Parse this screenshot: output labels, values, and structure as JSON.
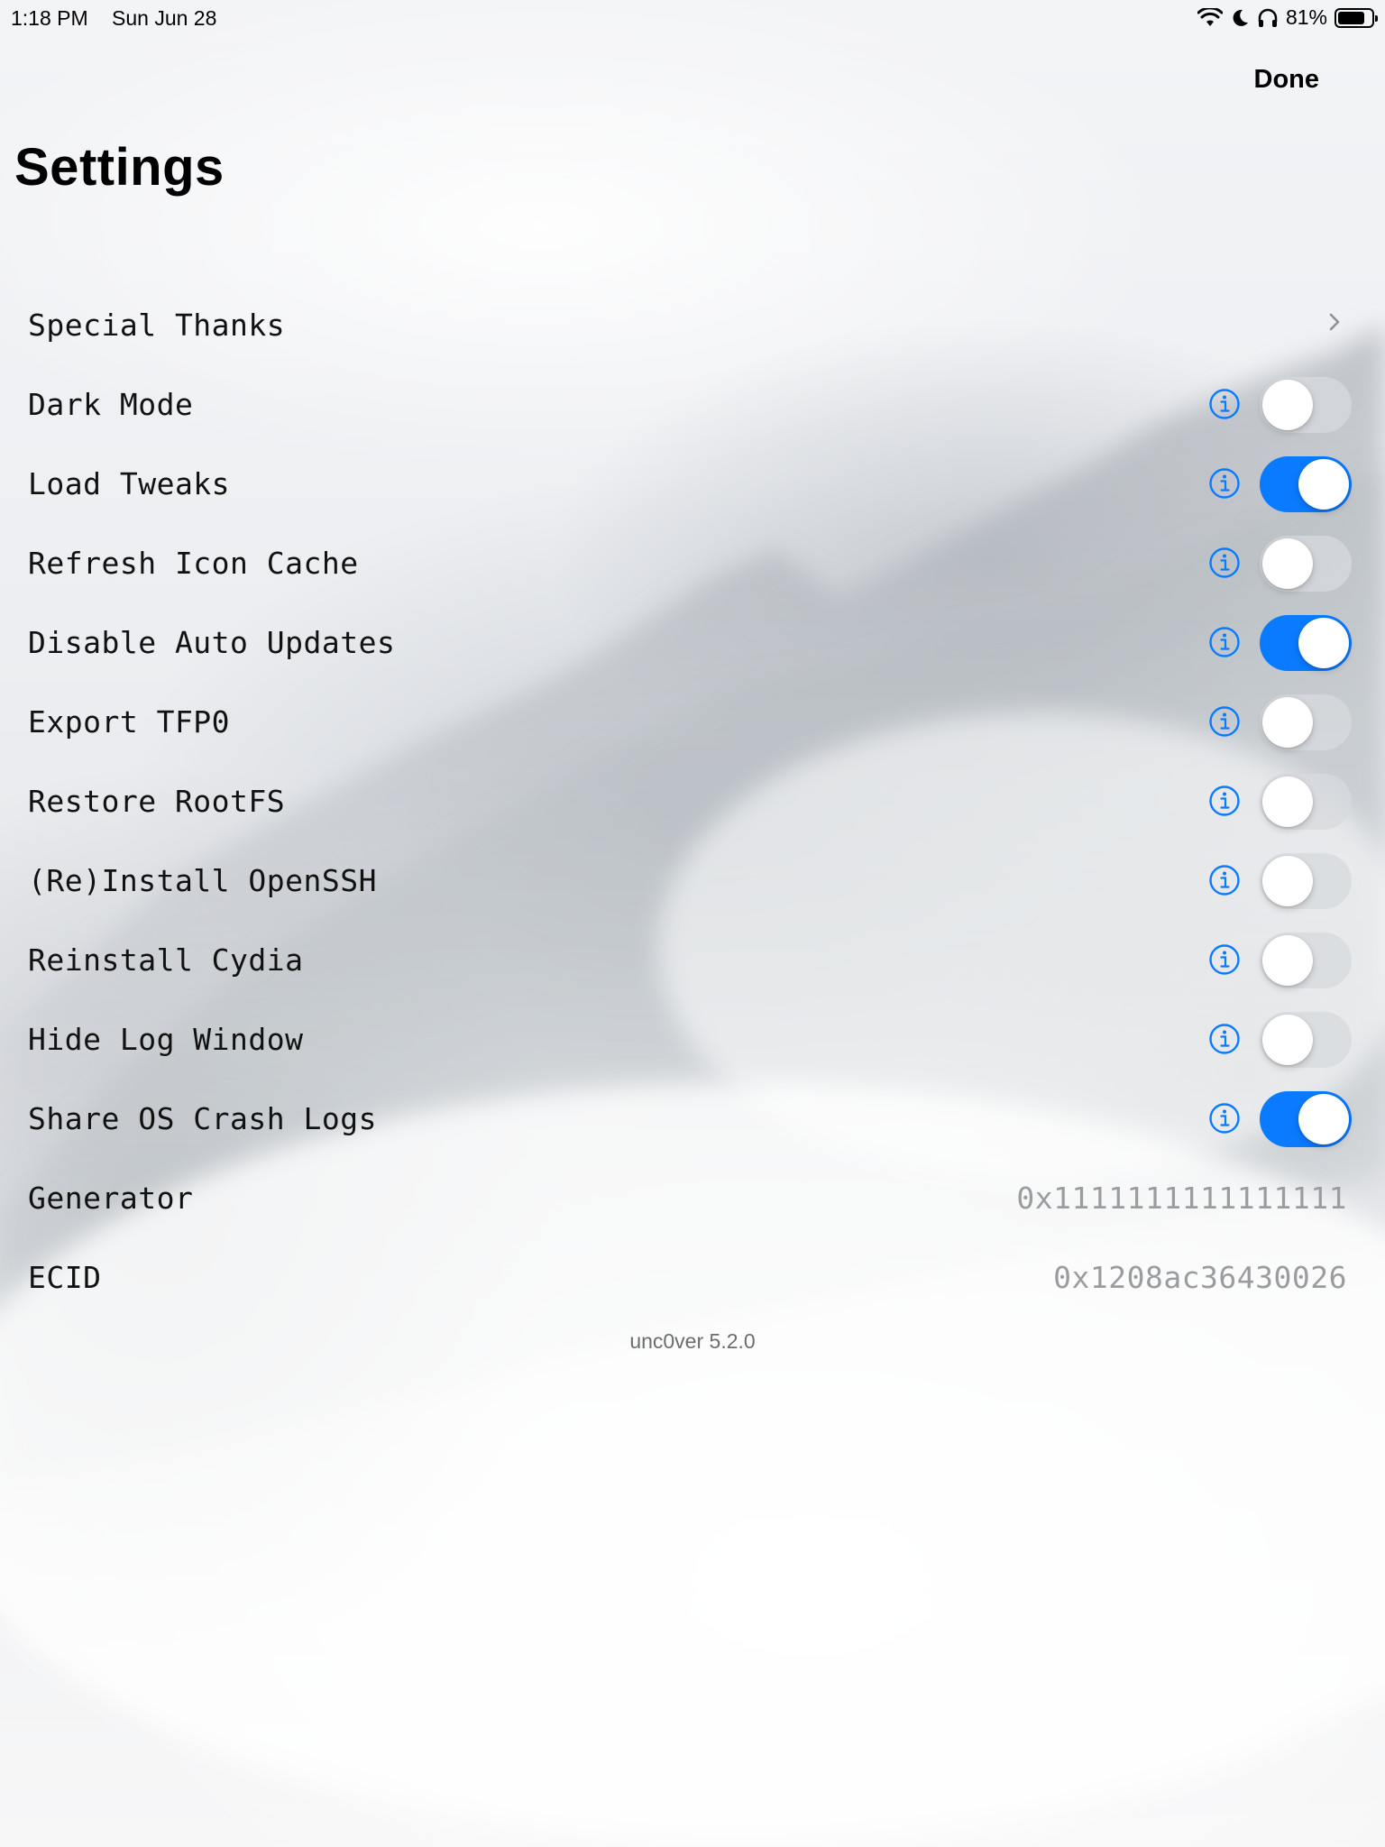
{
  "status_bar": {
    "time": "1:18 PM",
    "date": "Sun Jun 28",
    "battery_text": "81%",
    "battery_level": 0.81,
    "icons": [
      "wifi-icon",
      "moon-icon",
      "headphones-icon",
      "battery-icon"
    ]
  },
  "nav": {
    "done_label": "Done",
    "title": "Settings"
  },
  "colors": {
    "accent": "#0a7aff",
    "toggle_off": "#d7dade",
    "value_text": "#9a9ca0"
  },
  "settings": {
    "special_thanks": {
      "label": "Special Thanks",
      "icon": "chevron-right-icon"
    },
    "toggles": [
      {
        "label": "Dark Mode",
        "on": false
      },
      {
        "label": "Load Tweaks",
        "on": true
      },
      {
        "label": "Refresh Icon Cache",
        "on": false
      },
      {
        "label": "Disable Auto Updates",
        "on": true
      },
      {
        "label": "Export TFP0",
        "on": false
      },
      {
        "label": "Restore RootFS",
        "on": false
      },
      {
        "label": "(Re)Install OpenSSH",
        "on": false
      },
      {
        "label": "Reinstall Cydia",
        "on": false
      },
      {
        "label": "Hide Log Window",
        "on": false
      },
      {
        "label": "Share OS Crash Logs",
        "on": true
      }
    ],
    "values": [
      {
        "label": "Generator",
        "value": "0x1111111111111111"
      },
      {
        "label": "ECID",
        "value": "0x1208ac36430026"
      }
    ]
  },
  "footer": {
    "version": "unc0ver 5.2.0"
  }
}
